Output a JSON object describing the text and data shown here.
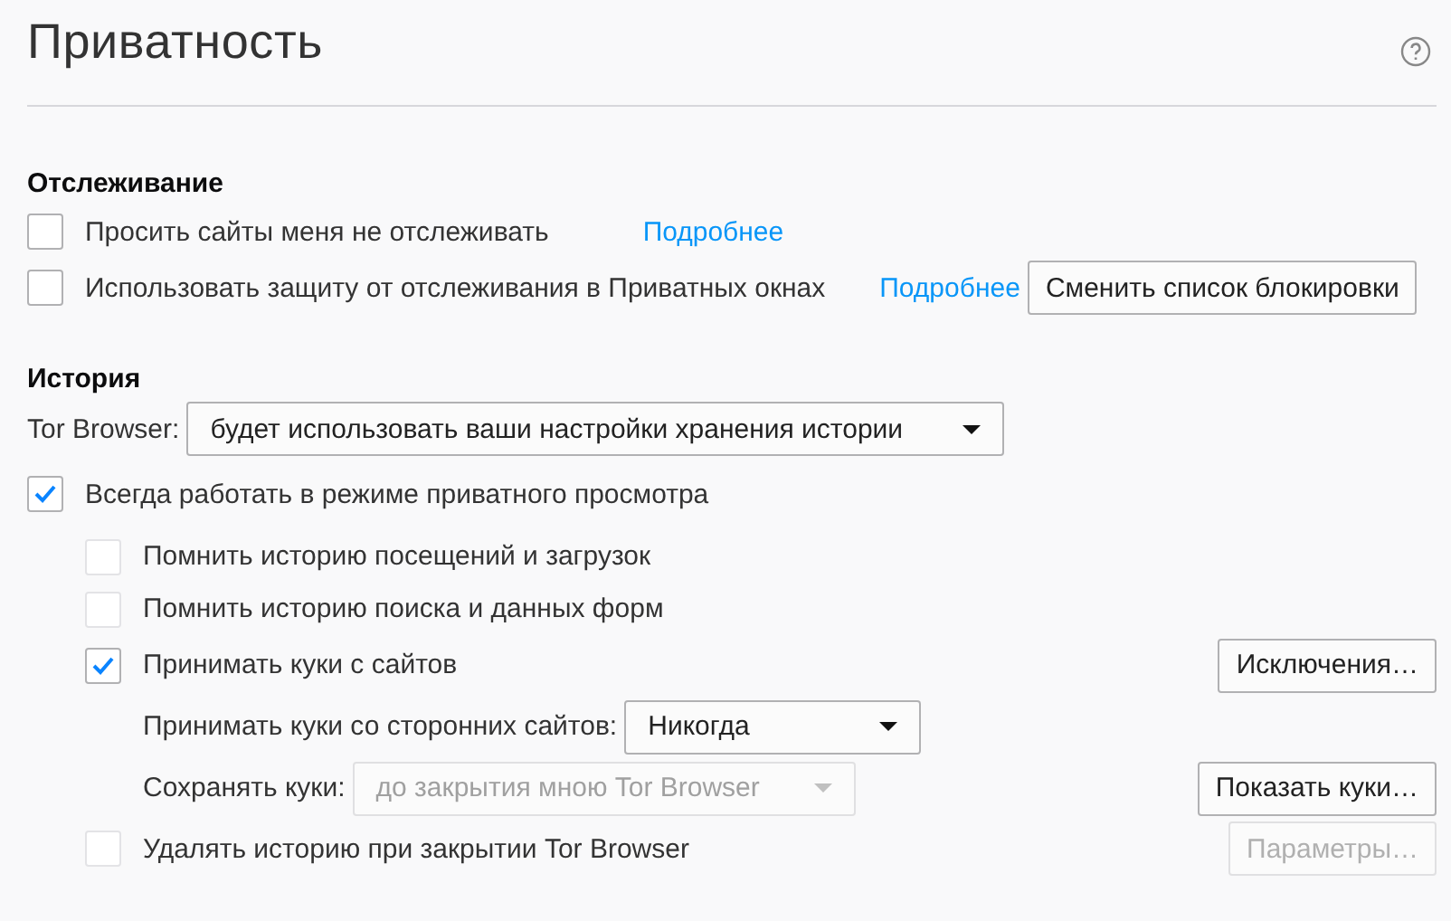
{
  "page": {
    "title": "Приватность"
  },
  "tracking": {
    "heading": "Отслеживание",
    "rows": [
      {
        "kind": "checkbox",
        "label": "Просить сайты меня не отслеживать",
        "checked": false,
        "link": "Подробнее"
      },
      {
        "kind": "checkbox",
        "label": "Использовать защиту от отслеживания в Приватных окнах",
        "checked": false,
        "link": "Подробнее",
        "button": "Сменить список блокировки"
      }
    ]
  },
  "history": {
    "heading": "История",
    "mode_label": "Tor Browser:",
    "mode_value": "будет использовать ваши настройки хранения истории",
    "items": [
      {
        "kind": "checkbox",
        "label": "Всегда работать в режиме приватного просмотра",
        "checked": true,
        "disabled": false,
        "children": [
          {
            "kind": "checkbox",
            "label": "Помнить историю посещений и загрузок",
            "checked": false,
            "disabled": true
          },
          {
            "kind": "checkbox",
            "label": "Помнить историю поиска и данных форм",
            "checked": false,
            "disabled": true
          },
          {
            "kind": "checkbox",
            "label": "Принимать куки с сайтов",
            "checked": true,
            "disabled": false,
            "button": {
              "label": "Исключения…",
              "disabled": false
            },
            "children": [
              {
                "kind": "select",
                "label": "Принимать куки со сторонних сайтов:",
                "value": "Никогда",
                "disabled": false
              },
              {
                "kind": "select",
                "label": "Сохранять куки:",
                "value": "до закрытия мною Tor Browser",
                "disabled": true,
                "button": {
                  "label": "Показать куки…",
                  "disabled": false
                }
              }
            ]
          },
          {
            "kind": "checkbox",
            "label": "Удалять историю при закрытии Tor Browser",
            "checked": false,
            "disabled": true,
            "button": {
              "label": "Параметры…",
              "disabled": true
            }
          }
        ]
      }
    ]
  }
}
